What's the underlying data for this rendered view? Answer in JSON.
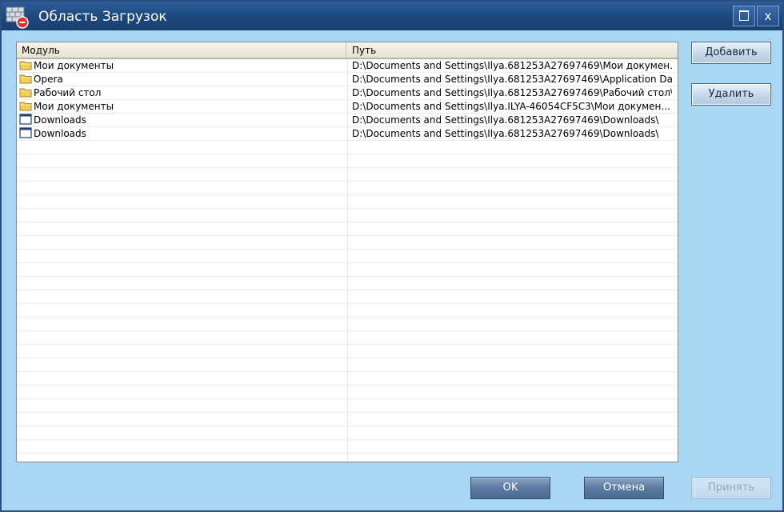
{
  "window": {
    "title": "Область Загрузок"
  },
  "titlebar": {
    "maximize_glyph": "□",
    "close_glyph": "x"
  },
  "list": {
    "columns": [
      "Модуль",
      "Путь"
    ],
    "rows": [
      {
        "module": "Мои документы",
        "path": "D:\\Documents and Settings\\Ilya.681253A27697469\\Мои докумен...",
        "icon": "folder-icon"
      },
      {
        "module": "Opera",
        "path": "D:\\Documents and Settings\\Ilya.681253A27697469\\Application Da...",
        "icon": "folder-icon"
      },
      {
        "module": "Рабочий стол",
        "path": "D:\\Documents and Settings\\Ilya.681253A27697469\\Рабочий стол\\",
        "icon": "folder-icon"
      },
      {
        "module": "Мои документы",
        "path": "D:\\Documents and Settings\\Ilya.ILYA-46054CF5C3\\Мои докумен...",
        "icon": "folder-icon"
      },
      {
        "module": "Downloads",
        "path": "D:\\Documents and Settings\\Ilya.681253A27697469\\Downloads\\",
        "icon": "window-icon"
      },
      {
        "module": "Downloads",
        "path": "D:\\Documents and Settings\\Ilya.681253A27697469\\Downloads\\",
        "icon": "window-icon"
      }
    ],
    "empty_rows": 24
  },
  "buttons": {
    "add": "Добавить",
    "delete": "Удалить",
    "ok": "OK",
    "cancel": "Отмена",
    "apply": "Принять"
  },
  "colors": {
    "titlebar": "#1e477d",
    "window_bg": "#a9d6f3",
    "dark_button": "#5c7aa1",
    "disabled_text": "#8fa9c2"
  }
}
